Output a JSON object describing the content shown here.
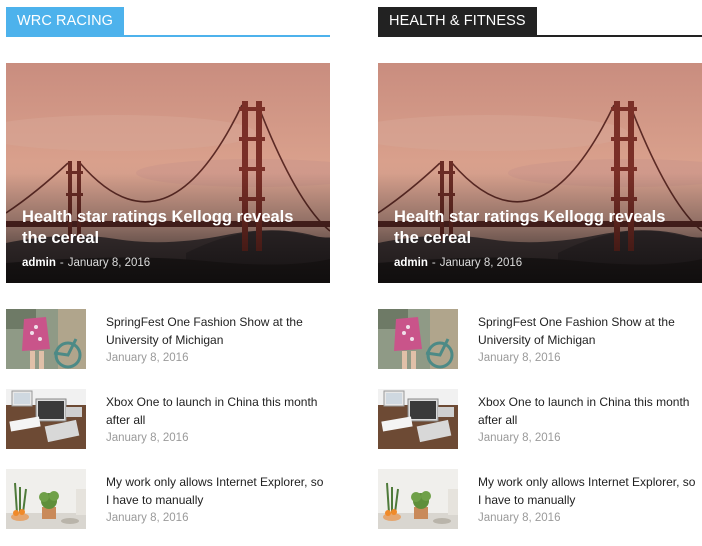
{
  "colors": {
    "wrc_accent": "#4db2ec",
    "health_accent": "#222222"
  },
  "sections": [
    {
      "title": "WRC RACING",
      "featured": {
        "title": "Health star ratings Kellogg reveals the cereal",
        "author": "admin",
        "separator": "-",
        "date": "January 8, 2016",
        "image": "golden-gate-bridge-sunset"
      },
      "items": [
        {
          "title": "SpringFest One Fashion Show at the University of Michigan",
          "date": "January 8, 2016",
          "image": "woman-with-bicycle"
        },
        {
          "title": "Xbox One to launch in China this month after all",
          "date": "January 8, 2016",
          "image": "desk-with-computers"
        },
        {
          "title": "My work only allows Internet Explorer, so I have to manually",
          "date": "January 8, 2016",
          "image": "plants-on-table"
        }
      ]
    },
    {
      "title": "HEALTH & FITNESS",
      "featured": {
        "title": "Health star ratings Kellogg reveals the cereal",
        "author": "admin",
        "separator": "-",
        "date": "January 8, 2016",
        "image": "golden-gate-bridge-sunset"
      },
      "items": [
        {
          "title": "SpringFest One Fashion Show at the University of Michigan",
          "date": "January 8, 2016",
          "image": "woman-with-bicycle"
        },
        {
          "title": "Xbox One to launch in China this month after all",
          "date": "January 8, 2016",
          "image": "desk-with-computers"
        },
        {
          "title": "My work only allows Internet Explorer, so I have to manually",
          "date": "January 8, 2016",
          "image": "plants-on-table"
        }
      ]
    }
  ]
}
